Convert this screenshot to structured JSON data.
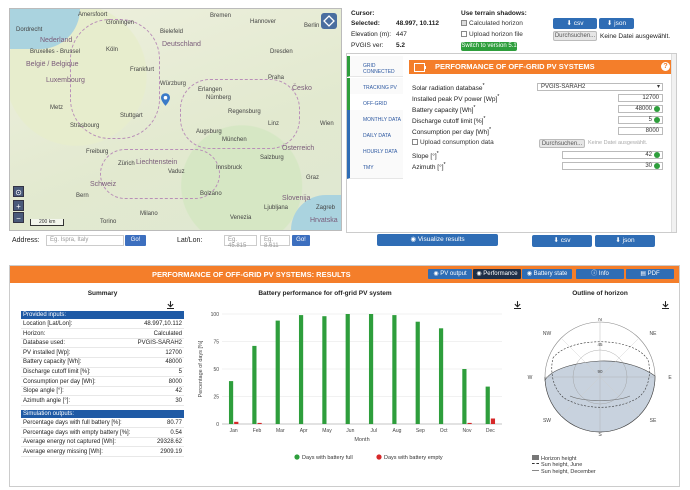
{
  "map": {
    "labels": {
      "amsterdam": "Amersfoort",
      "groningen": "Groningen",
      "bremen": "Bremen",
      "hannover": "Hannover",
      "berlin": "Berlin",
      "dordrecht": "Dordrecht",
      "netherlands": "Nederland",
      "bielefeld": "Bielefeld",
      "bruxelles": "Bruxelles - Brussel",
      "belgium": "België / Belgique",
      "koln": "Köln",
      "germany": "Deutschland",
      "dresden": "Dresden",
      "frankfurt": "Frankfurt",
      "luxembourg": "Luxembourg",
      "praha": "Praha",
      "czechia": "Česko",
      "nurnberg": "Nürnberg",
      "wurzburg": "Würzburg",
      "erlangen": "Erlangen",
      "regensburg": "Regensburg",
      "metz": "Metz",
      "strasbourg": "Strasbourg",
      "stuttgart": "Stuttgart",
      "augsburg": "Augsburg",
      "munchen": "München",
      "linz": "Linz",
      "wien": "Wien",
      "osterreich": "Österreich",
      "freiburg": "Freiburg",
      "zurich": "Zürich",
      "liechtenstein": "Liechtenstein",
      "vaduz": "Vaduz",
      "salzburg": "Salzburg",
      "innsbruck": "Innsbruck",
      "schweiz": "Schweiz",
      "bern": "Bern",
      "bolzano": "Bolzano",
      "graz": "Graz",
      "slovenija": "Slovenija",
      "ljubljana": "Ljubljana",
      "zagreb": "Zagreb",
      "hrvatska": "Hrvatska",
      "milano": "Milano",
      "venezia": "Venezia",
      "torino": "Torino"
    },
    "scale": "200 km",
    "zoom_in": "+",
    "zoom_out": "−"
  },
  "address": {
    "label": "Address:",
    "placeholder": "Eg. Ispra, Italy",
    "go_label": "Go!",
    "latlon_label": "Lat/Lon:",
    "lat_placeholder": "Eg. 45.815",
    "lon_placeholder": "Eg. 8.611",
    "go2_label": "Go!"
  },
  "info": {
    "cursor_label": "Cursor:",
    "selected_label": "Selected:",
    "selected_value": "48.997, 10.112",
    "elevation_label": "Elevation (m):",
    "elevation_value": "447",
    "pvgis_label": "PVGIS ver:",
    "pvgis_value": "5.2",
    "terrain_title": "Use terrain shadows:",
    "calc_horizon": "Calculated horizon",
    "upload_horizon": "Upload horizon file",
    "switch_label": "Switch to version 5.1",
    "csv_label": "csv",
    "json_label": "json",
    "browse_label": "Durchsuchen...",
    "no_file": "Keine Datei ausgewählt."
  },
  "tabs": [
    "GRID CONNECTED",
    "TRACKING PV",
    "OFF-GRID",
    "MONTHLY DATA",
    "DAILY DATA",
    "HOURLY DATA",
    "TMY"
  ],
  "tool": {
    "title": "PERFORMANCE OF OFF-GRID PV SYSTEMS",
    "help": "?",
    "db_label": "Solar radiation database",
    "db_value": "PVGIS-SARAH2",
    "power_label": "Installed peak PV power [Wp]",
    "power_value": "12700",
    "battery_label": "Battery capacity [Wh]",
    "battery_value": "48000",
    "cutoff_label": "Discharge cutoff limit [%]",
    "cutoff_value": "5",
    "consumption_label": "Consumption per day [Wh]",
    "consumption_value": "8000",
    "upload_consumption": "Upload consumption data",
    "browse_label": "Durchsuchen...",
    "no_file": "Keine Datei ausgewählt.",
    "slope_label": "Slope [°]",
    "slope_value": "42",
    "azimuth_label": "Azimuth [°]",
    "azimuth_value": "30",
    "asterisk": "*"
  },
  "actions": {
    "visualize": "Visualize results",
    "csv": "csv",
    "json": "json"
  },
  "results": {
    "title": "PERFORMANCE OF OFF-GRID PV SYSTEMS: RESULTS",
    "buttons": [
      "PV output",
      "Performance",
      "Battery state",
      "Info",
      "PDF"
    ]
  },
  "summary": {
    "title": "Summary",
    "inputs_title": "Provided inputs:",
    "inputs": [
      {
        "k": "Location [Lat/Lon]:",
        "v": "48.997,10.112"
      },
      {
        "k": "Horizon:",
        "v": "Calculated"
      },
      {
        "k": "Database used:",
        "v": "PVGIS-SARAH2"
      },
      {
        "k": "PV installed [Wp]:",
        "v": "12700"
      },
      {
        "k": "Battery capacity [Wh]:",
        "v": "48000"
      },
      {
        "k": "Discharge cutoff limit [%]:",
        "v": "5"
      },
      {
        "k": "Consumption per day [Wh]:",
        "v": "8000"
      },
      {
        "k": "Slope angle [°]:",
        "v": "42"
      },
      {
        "k": "Azimuth angle [°]:",
        "v": "30"
      }
    ],
    "outputs_title": "Simulation outputs:",
    "outputs": [
      {
        "k": "Percentage days with full battery [%]:",
        "v": "80.77"
      },
      {
        "k": "Percentage days with empty battery [%]:",
        "v": "0.54"
      },
      {
        "k": "Average energy not captured [Wh]:",
        "v": "29328.62"
      },
      {
        "k": "Average energy missing [Wh]:",
        "v": "2909.19"
      }
    ]
  },
  "chart_data": {
    "type": "bar",
    "title": "Battery performance for off-grid PV system",
    "xlabel": "Month",
    "ylabel": "Percentage of days [%]",
    "ylim": [
      0,
      100
    ],
    "yticks": [
      0,
      25,
      50,
      75,
      100
    ],
    "categories": [
      "Jan",
      "Feb",
      "Mar",
      "Apr",
      "May",
      "Jun",
      "Jul",
      "Aug",
      "Sep",
      "Oct",
      "Nov",
      "Dec"
    ],
    "series": [
      {
        "name": "Days with battery full",
        "color": "#2e9e3c",
        "values": [
          39,
          71,
          94,
          99,
          98,
          100,
          100,
          99,
          93,
          87,
          50,
          34
        ]
      },
      {
        "name": "Days with battery empty",
        "color": "#d62728",
        "values": [
          2,
          1,
          0,
          0,
          0,
          0,
          0,
          0,
          0,
          0,
          1,
          5
        ]
      }
    ],
    "legend": "bottom"
  },
  "horizon": {
    "title": "Outline of horizon",
    "labels": {
      "n": "N",
      "ne": "NE",
      "e": "E",
      "se": "SE",
      "s": "S",
      "sw": "SW",
      "w": "W",
      "nw": "NW",
      "r45": "45",
      "r90": "90"
    },
    "legend": [
      "Horizon height",
      "Sun height, June",
      "Sun height, December"
    ]
  }
}
